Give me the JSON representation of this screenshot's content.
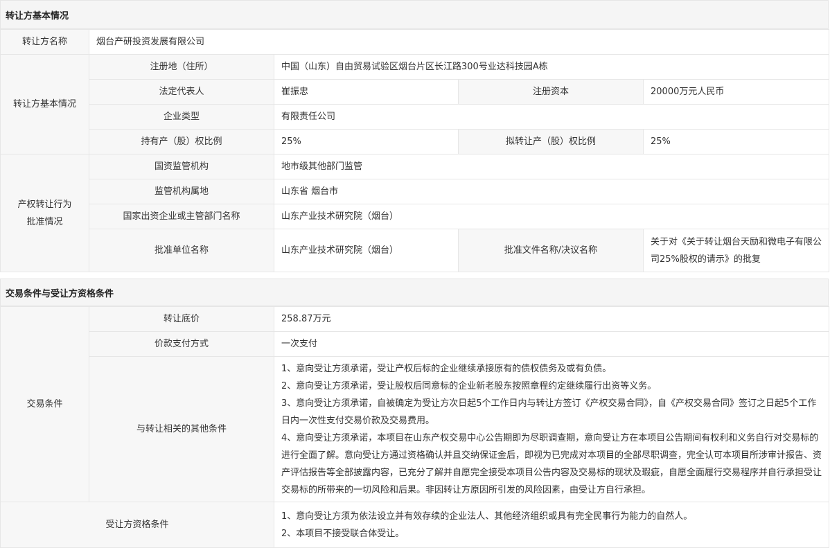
{
  "section1": {
    "title": "转让方基本情况",
    "name_label": "转让方名称",
    "name_value": "烟台产研投资发展有限公司",
    "group_label": "转让方基本情况",
    "address_label": "注册地（住所）",
    "address_value": "中国（山东）自由贸易试验区烟台片区长江路300号业达科技园A栋",
    "rep_label": "法定代表人",
    "rep_value": "崔振忠",
    "capital_label": "注册资本",
    "capital_value": "20000万元人民币",
    "type_label": "企业类型",
    "type_value": "有限责任公司",
    "hold_label": "持有产（股）权比例",
    "hold_value": "25%",
    "transfer_ratio_label": "拟转让产（股）权比例",
    "transfer_ratio_value": "25%",
    "approval_group_line1": "产权转让行为",
    "approval_group_line2": "批准情况",
    "regulator_label": "国资监管机构",
    "regulator_value": "地市级其他部门监管",
    "regulator_loc_label": "监管机构属地",
    "regulator_loc_value": "山东省 烟台市",
    "parent_label": "国家出资企业或主管部门名称",
    "parent_value": "山东产业技术研究院（烟台）",
    "approver_label": "批准单位名称",
    "approver_value": "山东产业技术研究院（烟台）",
    "approval_doc_label": "批准文件名称/决议名称",
    "approval_doc_value": "关于对《关于转让烟台天励和微电子有限公司25%股权的请示》的批复"
  },
  "section2": {
    "title": "交易条件与受让方资格条件",
    "group_label": "交易条件",
    "price_label": "转让底价",
    "price_value": "258.87万元",
    "payment_label": "价款支付方式",
    "payment_value": "一次支付",
    "other_label": "与转让相关的其他条件",
    "other_items": [
      "1、意向受让方须承诺，受让产权后标的企业继续承接原有的债权债务及或有负债。",
      "2、意向受让方须承诺，受让股权后同意标的企业新老股东按照章程约定继续履行出资等义务。",
      "3、意向受让方须承诺，自被确定为受让方次日起5个工作日内与转让方签订《产权交易合同》，自《产权交易合同》签订之日起5个工作日内一次性支付交易价款及交易费用。",
      "4、意向受让方须承诺，本项目在山东产权交易中心公告期即为尽职调查期，意向受让方在本项目公告期间有权利和义务自行对交易标的进行全面了解。意向受让方通过资格确认并且交纳保证金后，即视为已完成对本项目的全部尽职调查，完全认可本项目所涉审计报告、资产评估报告等全部披露内容，已充分了解并自愿完全接受本项目公告内容及交易标的现状及瑕疵，自愿全面履行交易程序并自行承担受让交易标的所带来的一切风险和后果。非因转让方原因所引发的风险因素，由受让方自行承担。"
    ],
    "qual_label": "受让方资格条件",
    "qual_items": [
      "1、意向受让方须为依法设立并有效存续的企业法人、其他经济组织或具有完全民事行为能力的自然人。",
      "2、本项目不接受联合体受让。"
    ]
  }
}
